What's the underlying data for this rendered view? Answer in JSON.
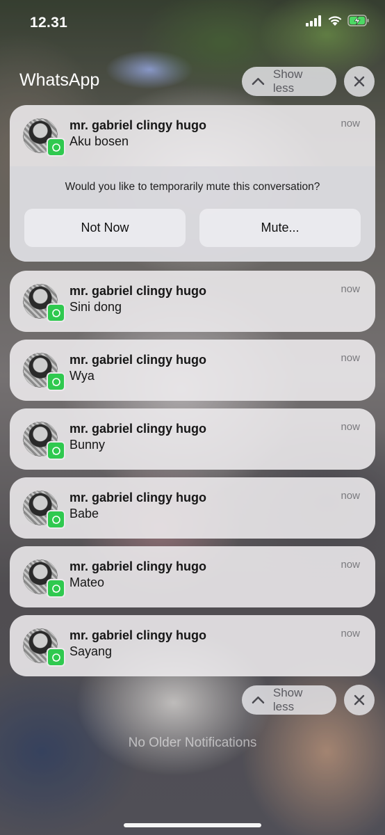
{
  "status_bar": {
    "time": "12.31",
    "icons": [
      "cellular-signal-icon",
      "wifi-icon",
      "battery-charging-icon"
    ]
  },
  "group": {
    "app_name": "WhatsApp",
    "show_less_label": "Show less",
    "close_icon": "close-icon"
  },
  "expanded_notification": {
    "sender": "mr. gabriel clingy hugo",
    "message": "Aku bosen",
    "time": "now",
    "mute_prompt": "Would you like to temporarily mute this conversation?",
    "not_now_label": "Not Now",
    "mute_label": "Mute..."
  },
  "notifications": [
    {
      "sender": "mr. gabriel clingy hugo",
      "message": "Sini dong",
      "time": "now"
    },
    {
      "sender": "mr. gabriel clingy hugo",
      "message": "Wya",
      "time": "now"
    },
    {
      "sender": "mr. gabriel clingy hugo",
      "message": "Bunny",
      "time": "now"
    },
    {
      "sender": "mr. gabriel clingy hugo",
      "message": "Babe",
      "time": "now"
    },
    {
      "sender": "mr. gabriel clingy hugo",
      "message": "Mateo",
      "time": "now"
    },
    {
      "sender": "mr. gabriel clingy hugo",
      "message": "Sayang",
      "time": "now"
    }
  ],
  "footer": {
    "show_less_label": "Show less",
    "no_older_text": "No Older Notifications"
  },
  "colors": {
    "whatsapp_green": "#2fc94f",
    "card_background": "#eeecee",
    "status_text": "#ffffff"
  }
}
